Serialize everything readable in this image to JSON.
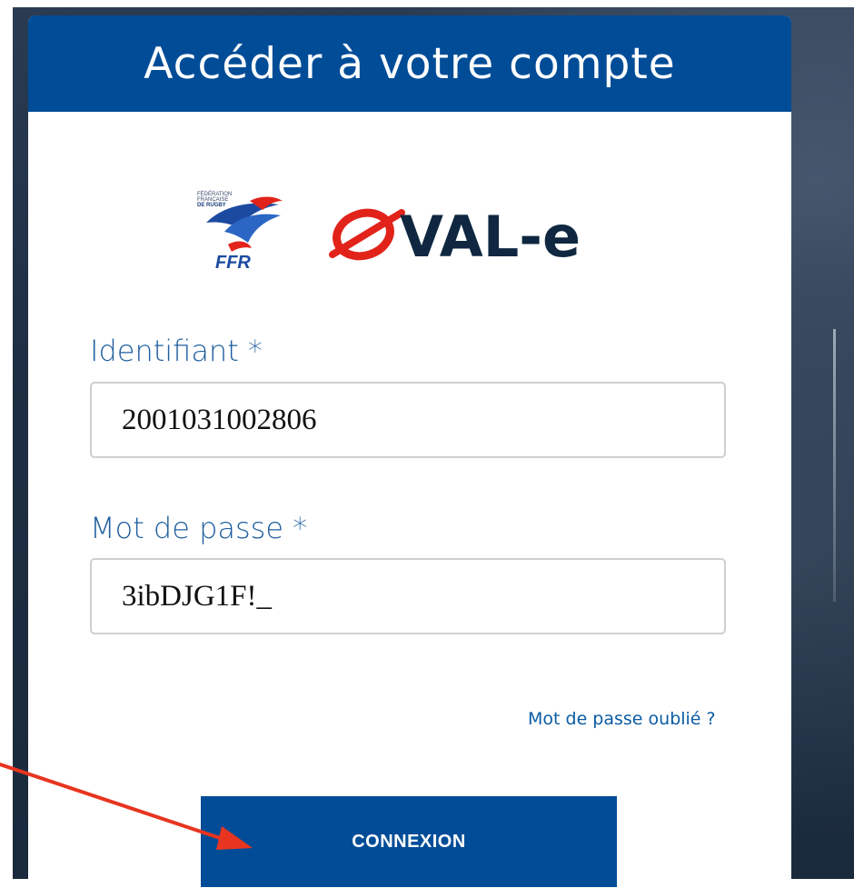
{
  "header": {
    "title": "Accéder à votre compte"
  },
  "logos": {
    "ffr_lines": [
      "FÉDÉRATION",
      "FRANÇAISE",
      "DE RUGBY"
    ],
    "ffr_text": "FFR",
    "oval_text": "VAL-e",
    "brand_blue": "#004c97",
    "oval_red": "#e2231a"
  },
  "form": {
    "identifiant_label": "Identifiant *",
    "identifiant_value": "2001031002806",
    "password_label": "Mot de passe *",
    "password_value": "3ibDJG1F!_",
    "forgot_link": "Mot de passe oublié ?",
    "submit_label": "CONNEXION"
  },
  "annotation": {
    "arrow_color": "#e8351f"
  }
}
